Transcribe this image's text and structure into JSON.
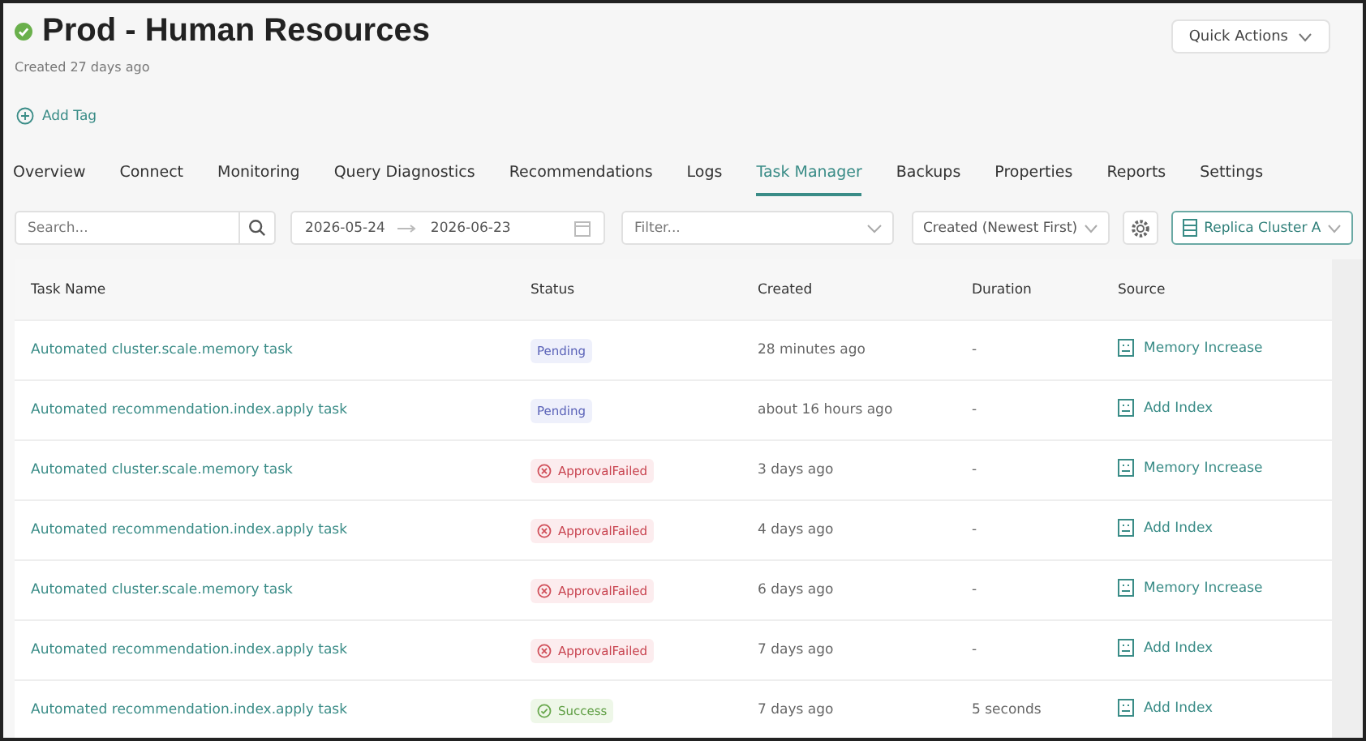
{
  "header": {
    "title": "Prod - Human Resources",
    "created": "Created 27 days ago",
    "add_tag": "Add Tag",
    "quick_actions": "Quick Actions"
  },
  "tabs": [
    {
      "label": "Overview",
      "selected": false
    },
    {
      "label": "Connect",
      "selected": false
    },
    {
      "label": "Monitoring",
      "selected": false
    },
    {
      "label": "Query Diagnostics",
      "selected": false
    },
    {
      "label": "Recommendations",
      "selected": false
    },
    {
      "label": "Logs",
      "selected": false
    },
    {
      "label": "Task Manager",
      "selected": true
    },
    {
      "label": "Backups",
      "selected": false
    },
    {
      "label": "Properties",
      "selected": false
    },
    {
      "label": "Reports",
      "selected": false
    },
    {
      "label": "Settings",
      "selected": false
    }
  ],
  "toolbar": {
    "search": {
      "placeholder": "Search..."
    },
    "date_from": "2026-05-24",
    "date_to": "2026-06-23",
    "filter": {
      "placeholder": "Filter..."
    },
    "sort": "Created (Newest First)",
    "cluster": "Replica Cluster A"
  },
  "table": {
    "columns": [
      "Task Name",
      "Status",
      "Created",
      "Duration",
      "Source"
    ],
    "rows": [
      {
        "task": "Automated cluster.scale.memory task",
        "status": "Pending",
        "kind": "pending",
        "created": "28 minutes ago",
        "duration": "-",
        "source": "Memory Increase"
      },
      {
        "task": "Automated recommendation.index.apply task",
        "status": "Pending",
        "kind": "pending",
        "created": "about 16 hours ago",
        "duration": "-",
        "source": "Add Index"
      },
      {
        "task": "Automated cluster.scale.memory task",
        "status": "ApprovalFailed",
        "kind": "failed",
        "created": "3 days ago",
        "duration": "-",
        "source": "Memory Increase"
      },
      {
        "task": "Automated recommendation.index.apply task",
        "status": "ApprovalFailed",
        "kind": "failed",
        "created": "4 days ago",
        "duration": "-",
        "source": "Add Index"
      },
      {
        "task": "Automated cluster.scale.memory task",
        "status": "ApprovalFailed",
        "kind": "failed",
        "created": "6 days ago",
        "duration": "-",
        "source": "Memory Increase"
      },
      {
        "task": "Automated recommendation.index.apply task",
        "status": "ApprovalFailed",
        "kind": "failed",
        "created": "7 days ago",
        "duration": "-",
        "source": "Add Index"
      },
      {
        "task": "Automated recommendation.index.apply task",
        "status": "Success",
        "kind": "success",
        "created": "7 days ago",
        "duration": "5 seconds",
        "source": "Add Index"
      }
    ]
  }
}
